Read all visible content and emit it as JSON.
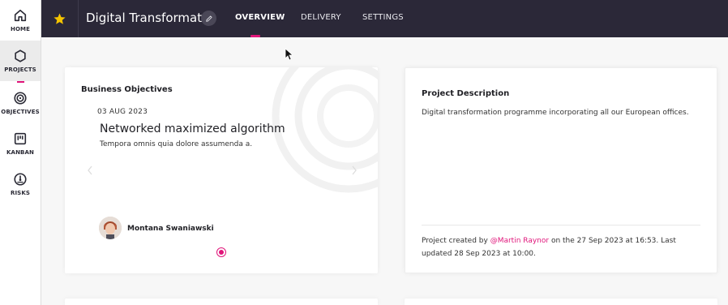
{
  "colors": {
    "accent": "#e0157a",
    "topbar_bg": "#2b2838",
    "star": "#f5c400"
  },
  "rail": {
    "items": [
      {
        "label": "HOME",
        "icon": "home-icon",
        "active": false
      },
      {
        "label": "PROJECTS",
        "icon": "hexagon-icon",
        "active": true
      },
      {
        "label": "OBJECTIVES",
        "icon": "target-icon",
        "active": false
      },
      {
        "label": "KANBAN",
        "icon": "kanban-board-icon",
        "active": false
      },
      {
        "label": "RISKS",
        "icon": "gauge-icon",
        "active": false
      }
    ]
  },
  "header": {
    "favorite_icon": "star-icon",
    "project_title": "Digital Transformat...",
    "edit_icon": "pencil-icon",
    "tabs": [
      {
        "label": "OVERVIEW",
        "active": true
      },
      {
        "label": "DELIVERY",
        "active": false
      },
      {
        "label": "SETTINGS",
        "active": false
      }
    ]
  },
  "objectives": {
    "heading": "Business Objectives",
    "date": "03 AUG 2023",
    "title": "Networked maximized algorithm",
    "description": "Tempora omnis quia dolore assumenda a.",
    "owner": "Montana Swaniawski",
    "prev_icon": "chevron-left-icon",
    "next_icon": "chevron-right-icon",
    "current_slide": 1,
    "total_slides": 1
  },
  "description": {
    "heading": "Project Description",
    "text": "Digital transformation programme incorporating all our European offices.",
    "meta_prefix": "Project created by ",
    "meta_user": "@Martin Raynor",
    "meta_suffix": " on the 27 Sep 2023 at 16:53. Last updated 28 Sep 2023 at 10:00."
  }
}
